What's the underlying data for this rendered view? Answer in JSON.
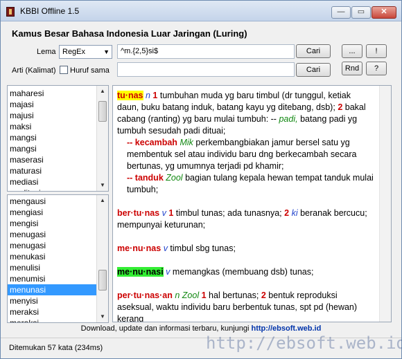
{
  "window": {
    "title": "KBBI Offline 1.5",
    "controls": {
      "minimize": "—",
      "maximize": "▭",
      "close": "✕"
    }
  },
  "heading": "Kamus Besar Bahasa Indonesia Luar Jaringan (Luring)",
  "search": {
    "lema_label": "Lema",
    "mode_value": "RegEx",
    "lema_value": "^m.{2,5}si$",
    "cari_label": "Cari",
    "arti_label": "Arti (Kalimat)",
    "huruf_sama_label": "Huruf sama",
    "arti_value": "",
    "cari2_label": "Cari"
  },
  "side_buttons": {
    "dots": "...",
    "excl": "!",
    "rnd": "Rnd",
    "help": "?"
  },
  "top_list": [
    "maharesi",
    "majasi",
    "majusi",
    "maksi",
    "mangsi",
    "mangsi",
    "maserasi",
    "maturasi",
    "mediasi",
    "meditasi"
  ],
  "bottom_list": {
    "items": [
      "mengausi",
      "mengiasi",
      "mengisi",
      "menugasi",
      "menugasi",
      "menukasi",
      "menulisi",
      "menumisi",
      "menunasi",
      "menyisi",
      "meraksi",
      "meraksi"
    ],
    "selected_index": 8
  },
  "definition": {
    "e1": {
      "hw": "tu·nas",
      "pos": "n",
      "n1": "1",
      "t1": "tumbuhan muda yg baru timbul (dr tunggul, ketiak daun, buku batang induk, batang kayu yg ditebang, dsb);",
      "n2": "2",
      "t2": "bakal cabang (ranting) yg baru mulai tumbuh: --",
      "ex": "padi,",
      "t3": "batang padi yg tumbuh sesudah padi dituai;",
      "s1_hw": "-- kecambah",
      "s1_label": "Mik",
      "s1_text": "perkembangbiakan jamur bersel satu yg membentuk sel atau individu baru dng berkecambah secara bertunas, yg umumnya terjadi pd khamir;",
      "s2_hw": "-- tanduk",
      "s2_label": "Zool",
      "s2_text": "bagian tulang kepala hewan tempat tanduk mulai tumbuh;"
    },
    "e2": {
      "hw": "ber·tu·nas",
      "pos": "v",
      "n1": "1",
      "t1": "timbul tunas; ada tunasnya;",
      "n2": "2",
      "lbl": "ki",
      "t2": "beranak bercucu; mempunyai keturunan;"
    },
    "e3": {
      "hw": "me·nu·nas",
      "pos": "v",
      "t1": "timbul sbg tunas;"
    },
    "e4": {
      "hw": "me·nu·nasi",
      "pos": "v",
      "t1": "memangkas (membuang dsb) tunas;"
    },
    "e5": {
      "hw": "per·tu·nas·an",
      "pos": "n",
      "label": "Zool",
      "n1": "1",
      "t1": "hal bertunas;",
      "n2": "2",
      "t2": "bentuk reproduksi aseksual, waktu individu baru berbentuk tunas, spt pd (hewan) kerang"
    }
  },
  "footer": {
    "text": "Download, update dan informasi terbaru, kunjungi",
    "link": "http://ebsoft.web.id"
  },
  "status": "Ditemukan 57 kata (234ms)",
  "watermark": "http://ebsoft.web.id",
  "colors": {
    "headword_red": "#cc0000",
    "highlight_yellow": "#ffff00",
    "highlight_green": "#33ee33",
    "pos_blue": "#2244cc",
    "label_green": "#118811",
    "selection": "#3399ff"
  }
}
